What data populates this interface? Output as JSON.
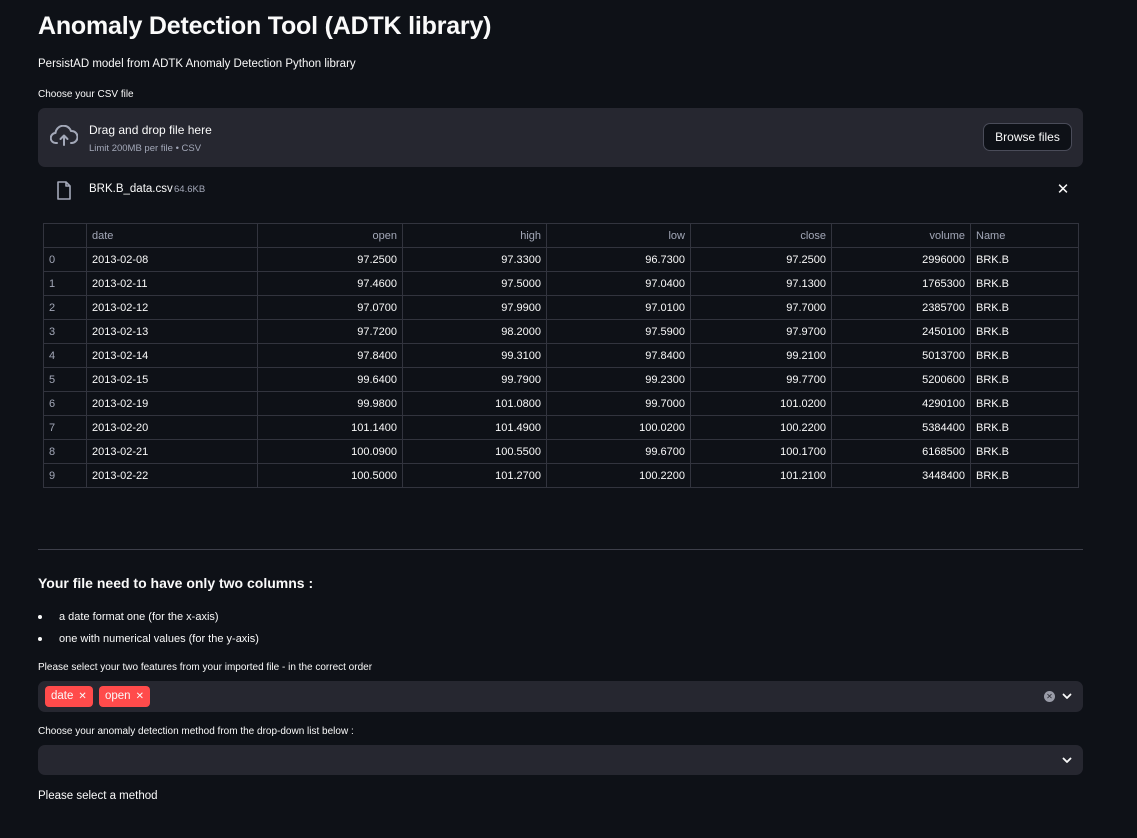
{
  "title": "Anomaly Detection Tool (ADTK library)",
  "subtitle": "PersistAD model from ADTK Anomaly Detection Python library",
  "uploader": {
    "label": "Choose your CSV file",
    "drag_text": "Drag and drop file here",
    "limit_text": "Limit 200MB per file • CSV",
    "browse_label": "Browse files",
    "file": {
      "name": "BRK.B_data.csv",
      "size": "64.6KB"
    }
  },
  "table": {
    "columns": [
      "",
      "date",
      "open",
      "high",
      "low",
      "close",
      "volume",
      "Name"
    ],
    "rows": [
      [
        "0",
        "2013-02-08",
        "97.2500",
        "97.3300",
        "96.7300",
        "97.2500",
        "2996000",
        "BRK.B"
      ],
      [
        "1",
        "2013-02-11",
        "97.4600",
        "97.5000",
        "97.0400",
        "97.1300",
        "1765300",
        "BRK.B"
      ],
      [
        "2",
        "2013-02-12",
        "97.0700",
        "97.9900",
        "97.0100",
        "97.7000",
        "2385700",
        "BRK.B"
      ],
      [
        "3",
        "2013-02-13",
        "97.7200",
        "98.2000",
        "97.5900",
        "97.9700",
        "2450100",
        "BRK.B"
      ],
      [
        "4",
        "2013-02-14",
        "97.8400",
        "99.3100",
        "97.8400",
        "99.2100",
        "5013700",
        "BRK.B"
      ],
      [
        "5",
        "2013-02-15",
        "99.6400",
        "99.7900",
        "99.2300",
        "99.7700",
        "5200600",
        "BRK.B"
      ],
      [
        "6",
        "2013-02-19",
        "99.9800",
        "101.0800",
        "99.7000",
        "101.0200",
        "4290100",
        "BRK.B"
      ],
      [
        "7",
        "2013-02-20",
        "101.1400",
        "101.4900",
        "100.0200",
        "100.2200",
        "5384400",
        "BRK.B"
      ],
      [
        "8",
        "2013-02-21",
        "100.0900",
        "100.5500",
        "99.6700",
        "100.1700",
        "6168500",
        "BRK.B"
      ],
      [
        "9",
        "2013-02-22",
        "100.5000",
        "101.2700",
        "100.2200",
        "101.2100",
        "3448400",
        "BRK.B"
      ]
    ]
  },
  "requirements": {
    "heading": "Your file need to have only two columns :",
    "items": [
      "a date format one (for the x-axis)",
      "one with numerical values (for the y-axis)"
    ]
  },
  "features": {
    "label": "Please select your two features from your imported file - in the correct order",
    "selected": [
      "date",
      "open"
    ]
  },
  "method": {
    "label": "Choose your anomaly detection method from the drop-down list below :",
    "value": "",
    "status": "Please select a method"
  },
  "colors": {
    "background": "#0e1117",
    "widget": "#262730",
    "accent": "#ff4b4b",
    "muted": "#a3a8b8"
  }
}
